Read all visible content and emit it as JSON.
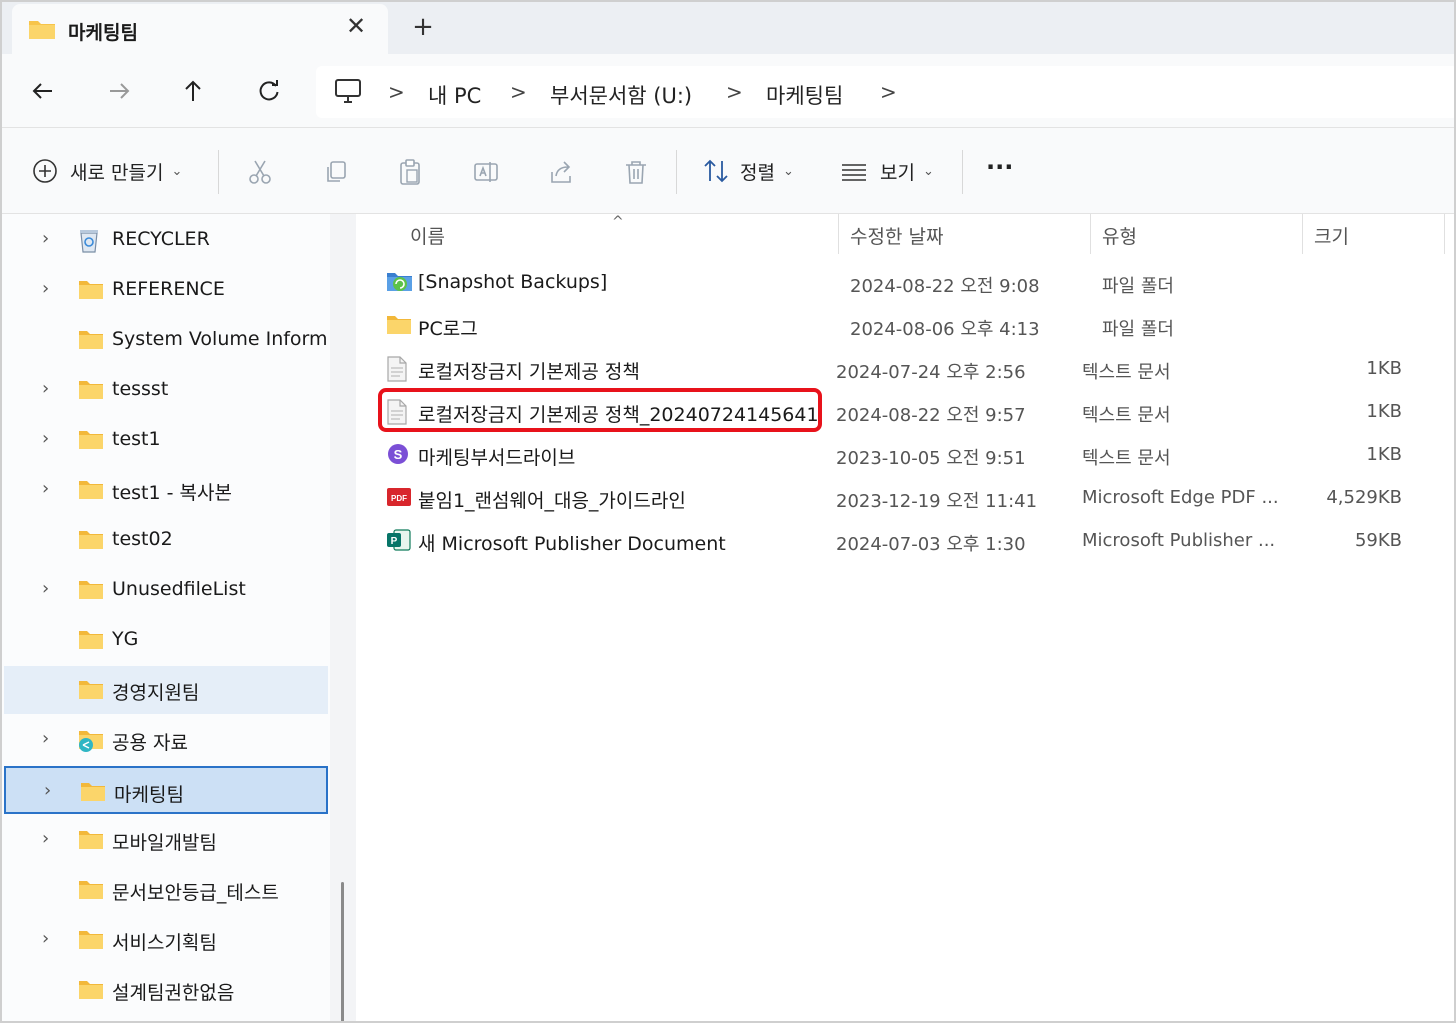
{
  "tab": {
    "title": "마케팅팀",
    "close_glyph": "✕",
    "new_tab_glyph": "+"
  },
  "breadcrumb": [
    "내 PC",
    "부서문서함 (U:)",
    "마케팅팀"
  ],
  "breadcrumb_separator": ">",
  "commands": {
    "new_label": "새로 만들기",
    "sort_label": "정렬",
    "view_label": "보기",
    "more_glyph": "···"
  },
  "sidebar": {
    "items": [
      {
        "label": "RECYCLER",
        "expandable": true,
        "icon": "recycler-icon"
      },
      {
        "label": "REFERENCE",
        "expandable": true,
        "icon": "folder-icon"
      },
      {
        "label": "System Volume Informati",
        "expandable": false,
        "icon": "folder-icon"
      },
      {
        "label": "tessst",
        "expandable": true,
        "icon": "folder-icon"
      },
      {
        "label": "test1",
        "expandable": true,
        "icon": "folder-icon"
      },
      {
        "label": "test1 - 복사본",
        "expandable": true,
        "icon": "folder-icon"
      },
      {
        "label": "test02",
        "expandable": false,
        "icon": "folder-icon"
      },
      {
        "label": "UnusedfileList",
        "expandable": true,
        "icon": "folder-icon"
      },
      {
        "label": "YG",
        "expandable": false,
        "icon": "folder-icon"
      },
      {
        "label": "경영지원팀",
        "expandable": false,
        "icon": "folder-icon",
        "state": "hover"
      },
      {
        "label": "공용 자료",
        "expandable": true,
        "icon": "shared-folder-icon"
      },
      {
        "label": "마케팅팀",
        "expandable": true,
        "icon": "folder-icon",
        "state": "selected"
      },
      {
        "label": "모바일개발팀",
        "expandable": true,
        "icon": "folder-icon"
      },
      {
        "label": "문서보안등급_테스트",
        "expandable": false,
        "icon": "folder-icon"
      },
      {
        "label": "서비스기획팀",
        "expandable": true,
        "icon": "folder-icon"
      },
      {
        "label": "설계팀권한없음",
        "expandable": false,
        "icon": "folder-icon"
      }
    ]
  },
  "columns": {
    "name": "이름",
    "date": "수정한 날짜",
    "type": "유형",
    "size": "크기"
  },
  "files": [
    {
      "name": "[Snapshot Backups]",
      "date": "2024-08-22 오전 9:08",
      "type": "파일 폴더",
      "size": "",
      "icon": "snapshot-folder-icon"
    },
    {
      "name": "PC로그",
      "date": "2024-08-06 오후 4:13",
      "type": "파일 폴더",
      "size": "",
      "icon": "folder-icon"
    },
    {
      "name": "로컬저장금지 기본제공 정책",
      "date": "2024-07-24 오후 2:56",
      "type": "텍스트 문서",
      "size": "1KB",
      "icon": "text-file-icon"
    },
    {
      "name": "로컬저장금지 기본제공 정책_20240724145641",
      "date": "2024-08-22 오전 9:57",
      "type": "텍스트 문서",
      "size": "1KB",
      "icon": "text-file-icon"
    },
    {
      "name": "마케팅부서드라이브",
      "date": "2023-10-05 오전 9:51",
      "type": "텍스트 문서",
      "size": "1KB",
      "icon": "drive-shortcut-icon"
    },
    {
      "name": "붙임1_랜섬웨어_대응_가이드라인",
      "date": "2023-12-19 오전 11:41",
      "type": "Microsoft Edge PDF ...",
      "size": "4,529KB",
      "icon": "pdf-icon"
    },
    {
      "name": "새 Microsoft Publisher Document",
      "date": "2024-07-03 오후 1:30",
      "type": "Microsoft Publisher ...",
      "size": "59KB",
      "icon": "publisher-icon"
    }
  ],
  "colors": {
    "highlight": "#e8121b",
    "selection": "#cce0f5",
    "selection_border": "#2a73c8",
    "folder": "#f7c44a"
  }
}
